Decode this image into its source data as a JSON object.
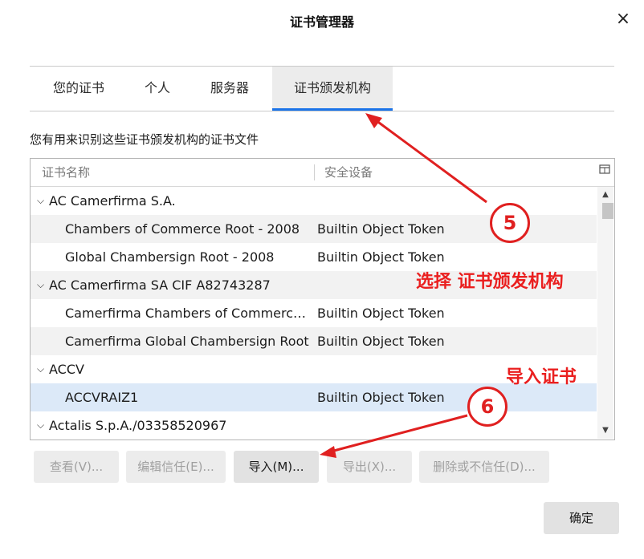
{
  "window": {
    "title": "证书管理器",
    "close_icon": "×"
  },
  "tabs": [
    {
      "label": "您的证书",
      "active": false
    },
    {
      "label": "个人",
      "active": false
    },
    {
      "label": "服务器",
      "active": false
    },
    {
      "label": "证书颁发机构",
      "active": true
    }
  ],
  "description": "您有用来识别这些证书颁发机构的证书文件",
  "columns": {
    "name": "证书名称",
    "device": "安全设备"
  },
  "rows": [
    {
      "type": "group",
      "name": "AC Camerfirma S.A.",
      "device": ""
    },
    {
      "type": "item",
      "name": "Chambers of Commerce Root - 2008",
      "device": "Builtin Object Token"
    },
    {
      "type": "item",
      "name": "Global Chambersign Root - 2008",
      "device": "Builtin Object Token"
    },
    {
      "type": "group",
      "name": "AC Camerfirma SA CIF A82743287",
      "device": ""
    },
    {
      "type": "item",
      "name": "Camerfirma Chambers of Commerce...",
      "device": "Builtin Object Token"
    },
    {
      "type": "item",
      "name": "Camerfirma Global Chambersign Root",
      "device": "Builtin Object Token"
    },
    {
      "type": "group",
      "name": "ACCV",
      "device": ""
    },
    {
      "type": "item",
      "name": "ACCVRAIZ1",
      "device": "Builtin Object Token",
      "selected": true
    },
    {
      "type": "group",
      "name": "Actalis S.p.A./03358520967",
      "device": ""
    }
  ],
  "buttons": {
    "view": "查看(V)...",
    "edit_trust": "编辑信任(E)...",
    "import": "导入(M)...",
    "export": "导出(X)...",
    "delete": "删除或不信任(D)...",
    "ok": "确定"
  },
  "annotations": {
    "step5": "5",
    "step5_text": "选择 证书颁发机构",
    "step6": "6",
    "step6_text": "导入证书"
  },
  "colors": {
    "accent": "#1a73e8",
    "annotation": "#e02020",
    "selected_row": "#dce9f8"
  },
  "icons": {
    "collapse": "chevron-down-icon",
    "column_picker": "column-picker-icon"
  }
}
